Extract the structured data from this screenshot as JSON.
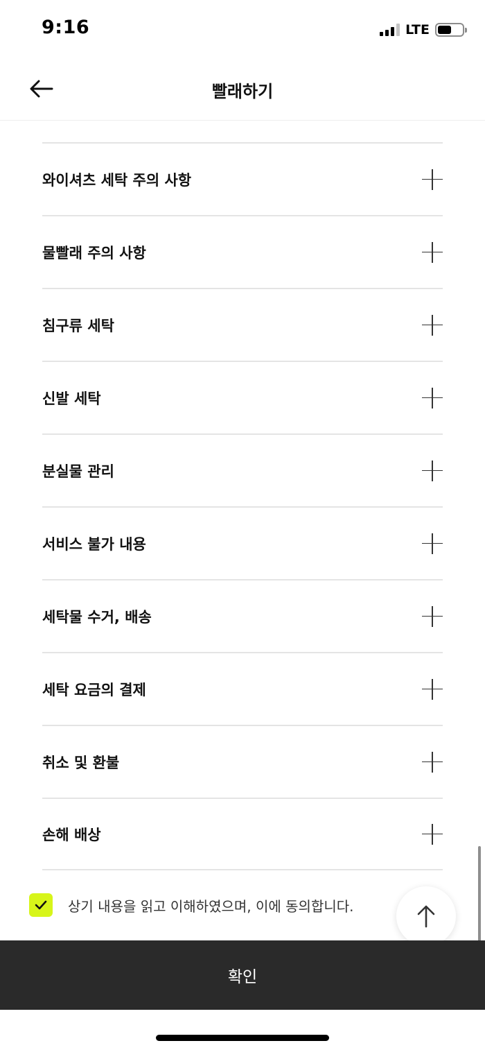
{
  "status_bar": {
    "time": "9:16",
    "network": "LTE",
    "battery_level": 0.55
  },
  "header": {
    "title": "빨래하기",
    "back_icon": "arrow-left-icon"
  },
  "sections": [
    {
      "label": "와이셔츠 세탁 주의 사항"
    },
    {
      "label": "물빨래 주의 사항"
    },
    {
      "label": "침구류 세탁"
    },
    {
      "label": "신발 세탁"
    },
    {
      "label": "분실물 관리"
    },
    {
      "label": "서비스 불가 내용"
    },
    {
      "label": "세탁물 수거, 배송"
    },
    {
      "label": "세탁 요금의 결제"
    },
    {
      "label": "취소 및 환불"
    },
    {
      "label": "손해 배상"
    }
  ],
  "agreement": {
    "checked": true,
    "text": "상기 내용을 읽고 이해하였으며, 이에 동의합니다."
  },
  "confirm_button": {
    "label": "확인"
  },
  "colors": {
    "accent": "#d7f51a",
    "button_bg": "#2a2a2a"
  }
}
